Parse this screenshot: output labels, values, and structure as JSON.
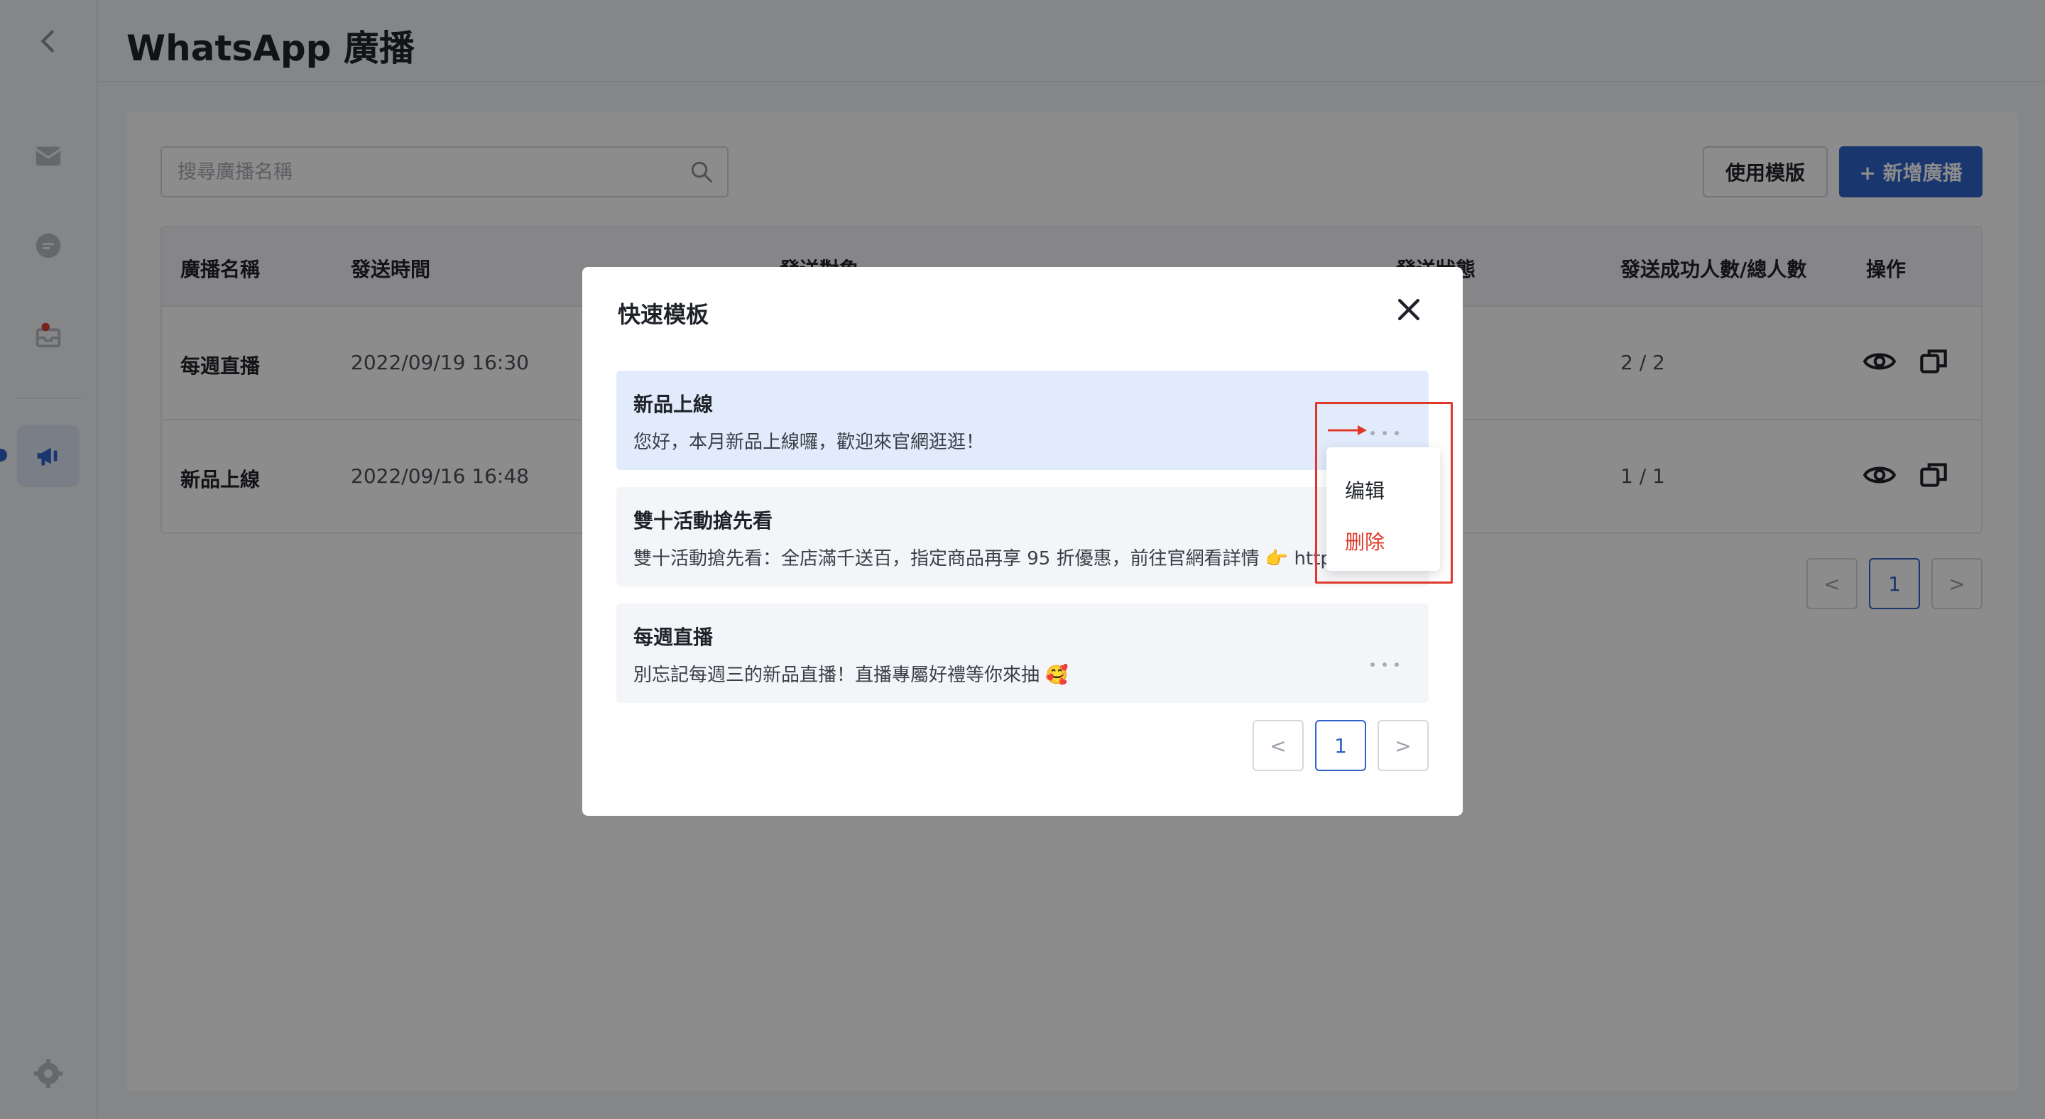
{
  "header": {
    "title": "WhatsApp 廣播"
  },
  "sidebar": {
    "items": [
      {
        "icon": "back-icon"
      },
      {
        "icon": "mail-icon"
      },
      {
        "icon": "chat-icon"
      },
      {
        "icon": "inbox-icon"
      },
      {
        "icon": "broadcast-icon"
      },
      {
        "icon": "gear-icon"
      }
    ]
  },
  "toolbar": {
    "search_placeholder": "搜尋廣播名稱",
    "use_template": "使用模版",
    "new_broadcast": "+ 新增廣播"
  },
  "table": {
    "headers": [
      "廣播名稱",
      "發送時間",
      "發送對象",
      "發送狀態",
      "發送成功人數/總人數",
      "操作"
    ],
    "rows": [
      {
        "name": "每週直播",
        "time": "2022/09/19 16:30",
        "ratio": "2 / 2"
      },
      {
        "name": "新品上線",
        "time": "2022/09/16 16:48",
        "ratio": "1 / 1"
      }
    ]
  },
  "pagination": {
    "current": "1",
    "prev": "<",
    "next": ">"
  },
  "modal": {
    "title": "快速模板",
    "templates": [
      {
        "name": "新品上線",
        "body": "您好，本月新品上線囉，歡迎來官網逛逛！"
      },
      {
        "name": "雙十活動搶先看",
        "body": "雙十活動搶先看：全店滿千送百，指定商品再享 95 折優惠，前往官網看詳情 👉 https"
      },
      {
        "name": "每週直播",
        "body": "別忘記每週三的新品直播！直播專屬好禮等你來抽 🥰"
      }
    ],
    "menu": {
      "edit": "编辑",
      "delete": "删除"
    },
    "pagination": {
      "current": "1",
      "prev": "<",
      "next": ">"
    }
  },
  "colors": {
    "accent": "#2f63c9",
    "danger": "#e0392b",
    "selected_bg": "#e2ebfb"
  }
}
